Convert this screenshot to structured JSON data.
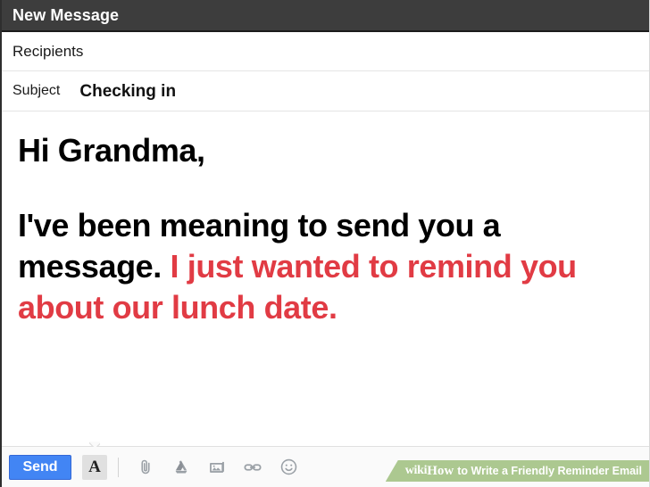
{
  "window": {
    "title": "New Message",
    "titlebar_bg": "#3d3d3d"
  },
  "fields": {
    "recipients_label": "Recipients",
    "recipients_value": "",
    "recipients_placeholder": "Recipients",
    "subject_label": "Subject",
    "subject_value": "Checking in",
    "subject_placeholder": "Subject"
  },
  "body": {
    "greeting": "Hi Grandma,",
    "paragraph_plain": "I've been meaning to send you a message. ",
    "paragraph_accent": "I just wanted to remind you about our lunch date.",
    "accent_color": "#e13b44"
  },
  "toolbar": {
    "send_label": "Send",
    "send_color": "#4285f4",
    "format_glyph": "A",
    "format_name": "formatting-options",
    "icons": [
      {
        "name": "attach-file-icon",
        "title": "Attach files"
      },
      {
        "name": "google-drive-icon",
        "title": "Insert files using Drive"
      },
      {
        "name": "insert-photo-icon",
        "title": "Insert photo"
      },
      {
        "name": "insert-link-icon",
        "title": "Insert link"
      },
      {
        "name": "insert-emoji-icon",
        "title": "Insert emoji"
      }
    ]
  },
  "watermark": {
    "wiki": "wiki",
    "how": "How",
    "rest": "to Write a Friendly Reminder Email",
    "bg_color": "#a9c68c"
  }
}
